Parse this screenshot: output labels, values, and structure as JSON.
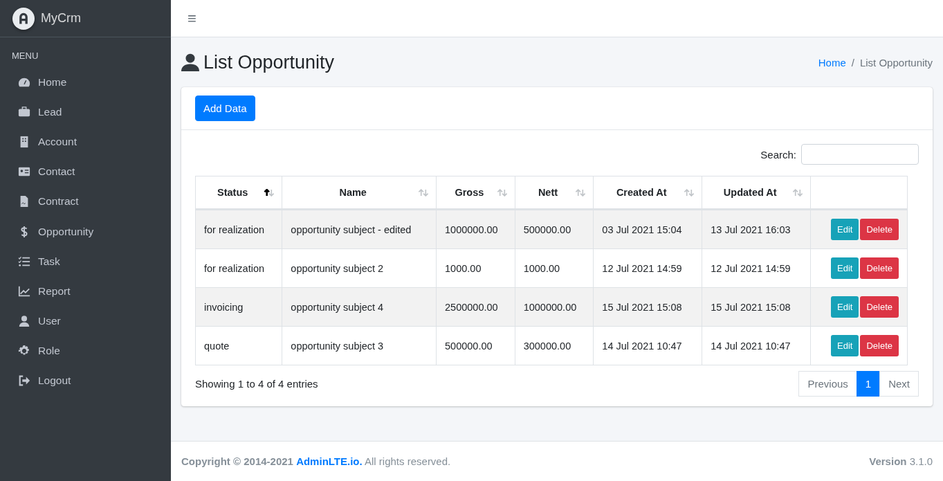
{
  "brand": {
    "name": "MyCrm"
  },
  "sidebar": {
    "header": "MENU",
    "items": [
      {
        "label": "Home"
      },
      {
        "label": "Lead"
      },
      {
        "label": "Account"
      },
      {
        "label": "Contact"
      },
      {
        "label": "Contract"
      },
      {
        "label": "Opportunity"
      },
      {
        "label": "Task"
      },
      {
        "label": "Report"
      },
      {
        "label": "User"
      },
      {
        "label": "Role"
      },
      {
        "label": "Logout"
      }
    ]
  },
  "topbar": {
    "menu_glyph": "≡"
  },
  "page": {
    "title": "List Opportunity",
    "breadcrumb": [
      {
        "label": "Home",
        "kind": "link"
      },
      {
        "label": "/",
        "kind": "separator"
      },
      {
        "label": "List Opportunity",
        "kind": "current"
      }
    ]
  },
  "card": {
    "add_button": "Add Data",
    "search": {
      "label": "Search:"
    },
    "table": {
      "columns": [
        {
          "label": "Status",
          "sortable": true,
          "sorted": true
        },
        {
          "label": "Name",
          "sortable": true,
          "sorted": false
        },
        {
          "label": "Gross",
          "sortable": true,
          "sorted": false
        },
        {
          "label": "Nett",
          "sortable": true,
          "sorted": false
        },
        {
          "label": "Created At",
          "sortable": true,
          "sorted": false
        },
        {
          "label": "Updated At",
          "sortable": true,
          "sorted": false
        },
        {
          "sortable": false
        }
      ],
      "rows": [
        {
          "cells": [
            "for realization",
            "opportunity subject - edited",
            "1000000.00",
            "500000.00",
            "03 Jul 2021 15:04",
            "13 Jul 2021 16:03"
          ],
          "actions": [
            "Edit",
            "Delete"
          ]
        },
        {
          "cells": [
            "for realization",
            "opportunity subject 2",
            "1000.00",
            "1000.00",
            "12 Jul 2021 14:59",
            "12 Jul 2021 14:59"
          ],
          "actions": [
            "Edit",
            "Delete"
          ]
        },
        {
          "cells": [
            "invoicing",
            "opportunity subject 4",
            "2500000.00",
            "1000000.00",
            "15 Jul 2021 15:08",
            "15 Jul 2021 15:08"
          ],
          "actions": [
            "Edit",
            "Delete"
          ]
        },
        {
          "cells": [
            "quote",
            "opportunity subject 3",
            "500000.00",
            "300000.00",
            "14 Jul 2021 10:47",
            "14 Jul 2021 10:47"
          ],
          "actions": [
            "Edit",
            "Delete"
          ]
        }
      ]
    },
    "info": "Showing 1 to 4 of 4 entries",
    "pagination": [
      {
        "label": "Previous",
        "selected": false
      },
      {
        "label": "1",
        "selected": true
      },
      {
        "label": "Next",
        "selected": false
      }
    ]
  },
  "footer": {
    "copyright": "**Copyright © 2014-2021**",
    "link": "AdminLTE.io.",
    "rest": "All rights reserved.",
    "version": "**Version** 3.1.0"
  }
}
